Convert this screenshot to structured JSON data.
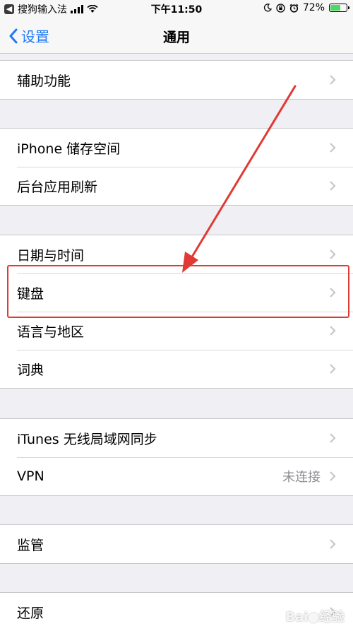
{
  "status_bar": {
    "back_app": "搜狗输入法",
    "time": "下午11:50",
    "battery_percent": "72%",
    "battery_level": 0.72
  },
  "nav": {
    "back_label": "设置",
    "title": "通用"
  },
  "groups": [
    {
      "rows": [
        {
          "label": "辅助功能"
        }
      ]
    },
    {
      "rows": [
        {
          "label": "iPhone 储存空间"
        },
        {
          "label": "后台应用刷新"
        }
      ]
    },
    {
      "rows": [
        {
          "label": "日期与时间"
        },
        {
          "label": "键盘"
        },
        {
          "label": "语言与地区"
        },
        {
          "label": "词典"
        }
      ]
    },
    {
      "rows": [
        {
          "label": "iTunes 无线局域网同步"
        },
        {
          "label": "VPN",
          "detail": "未连接"
        }
      ]
    },
    {
      "rows": [
        {
          "label": "监管"
        }
      ]
    },
    {
      "rows": [
        {
          "label": "还原"
        }
      ]
    }
  ],
  "annotation": {
    "highlighted_row": "键盘",
    "color": "#e03a34"
  },
  "icons": {
    "back": "chevron-left-icon",
    "disclosure": "chevron-right-icon",
    "wifi": "wifi-icon",
    "lock_rotation": "orientation-lock-icon",
    "alarm": "alarm-icon",
    "moon": "moon-icon"
  },
  "colors": {
    "accent": "#1f7af5",
    "background": "#efeff4",
    "battery": "#4cd964"
  }
}
